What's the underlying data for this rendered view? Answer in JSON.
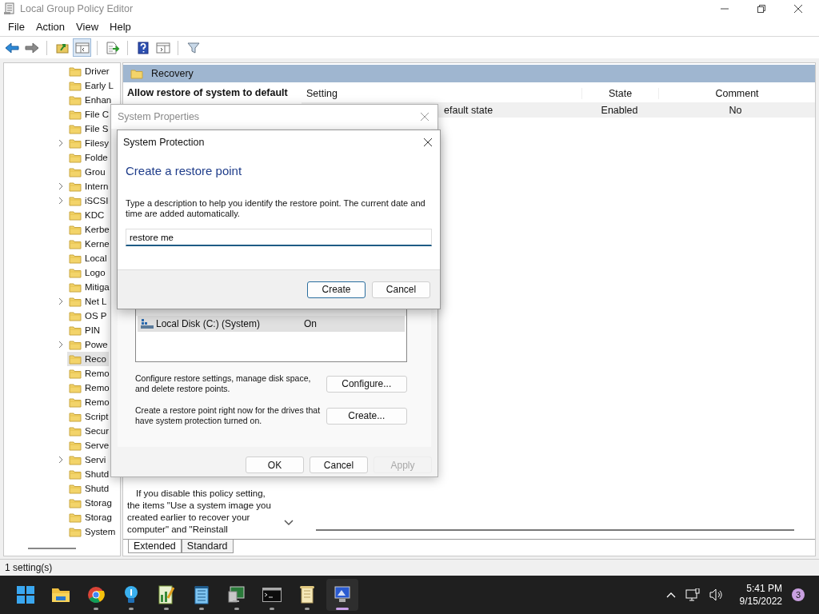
{
  "window": {
    "title": "Local Group Policy Editor"
  },
  "menu": [
    "File",
    "Action",
    "View",
    "Help"
  ],
  "toolbar": [
    {
      "buttons": [
        {
          "kind": "back",
          "selected": false
        },
        {
          "kind": "forward",
          "selected": false
        }
      ]
    },
    {
      "buttons": [
        {
          "kind": "up",
          "selected": false
        },
        {
          "kind": "tree",
          "selected": true
        }
      ]
    },
    {
      "buttons": [
        {
          "kind": "export",
          "selected": false
        }
      ]
    },
    {
      "buttons": [
        {
          "kind": "help",
          "selected": false
        },
        {
          "kind": "pane",
          "selected": false
        }
      ]
    },
    {
      "buttons": [
        {
          "kind": "filter",
          "selected": false
        }
      ]
    }
  ],
  "tree": {
    "items": [
      {
        "label": "Driver",
        "expandable": false,
        "selected": false
      },
      {
        "label": "Early L",
        "expandable": false,
        "selected": false
      },
      {
        "label": "Enhan",
        "expandable": false,
        "selected": false
      },
      {
        "label": "File C",
        "expandable": false,
        "selected": false
      },
      {
        "label": "File S",
        "expandable": false,
        "selected": false
      },
      {
        "label": "Filesy",
        "expandable": true,
        "selected": false
      },
      {
        "label": "Folde",
        "expandable": false,
        "selected": false
      },
      {
        "label": "Grou",
        "expandable": false,
        "selected": false
      },
      {
        "label": "Intern",
        "expandable": true,
        "selected": false
      },
      {
        "label": "iSCSI",
        "expandable": true,
        "selected": false
      },
      {
        "label": "KDC",
        "expandable": false,
        "selected": false
      },
      {
        "label": "Kerbe",
        "expandable": false,
        "selected": false
      },
      {
        "label": "Kerne",
        "expandable": false,
        "selected": false
      },
      {
        "label": "Local",
        "expandable": false,
        "selected": false
      },
      {
        "label": "Logo",
        "expandable": false,
        "selected": false
      },
      {
        "label": "Mitiga",
        "expandable": false,
        "selected": false
      },
      {
        "label": "Net L",
        "expandable": true,
        "selected": false
      },
      {
        "label": "OS P",
        "expandable": false,
        "selected": false
      },
      {
        "label": "PIN",
        "expandable": false,
        "selected": false
      },
      {
        "label": "Powe",
        "expandable": true,
        "selected": false
      },
      {
        "label": "Reco",
        "expandable": false,
        "selected": true
      },
      {
        "label": "Remo",
        "expandable": false,
        "selected": false
      },
      {
        "label": "Remo",
        "expandable": false,
        "selected": false
      },
      {
        "label": "Remo",
        "expandable": false,
        "selected": false
      },
      {
        "label": "Script",
        "expandable": false,
        "selected": false
      },
      {
        "label": "Secur",
        "expandable": false,
        "selected": false
      },
      {
        "label": "Serve",
        "expandable": false,
        "selected": false
      },
      {
        "label": "Servi",
        "expandable": true,
        "selected": false
      },
      {
        "label": "Shutd",
        "expandable": false,
        "selected": false
      },
      {
        "label": "Shutd",
        "expandable": false,
        "selected": false
      },
      {
        "label": "Storag",
        "expandable": false,
        "selected": false
      },
      {
        "label": "Storag",
        "expandable": false,
        "selected": false
      },
      {
        "label": "System",
        "expandable": false,
        "selected": false
      }
    ]
  },
  "details": {
    "header": "Recovery",
    "policy_title": "Allow restore of system to default",
    "description": "If you disable this policy setting, the items \"Use a system image you created earlier to recover your computer\" and \"Reinstall",
    "columns": [
      "Setting",
      "State",
      "Comment"
    ],
    "rows": [
      {
        "setting": "efault state",
        "state": "Enabled",
        "comment": "No",
        "selected": true
      }
    ],
    "view_tabs": [
      {
        "label": "Extended",
        "selected": true
      },
      {
        "label": "Standard",
        "selected": false
      }
    ]
  },
  "status_bar": "1 setting(s)",
  "system_properties": {
    "title": "System Properties",
    "drives": [
      {
        "name": "Local Disk (C:) (System)",
        "protection": "On",
        "selected": true
      }
    ],
    "actions": [
      {
        "text": "Configure restore settings, manage disk space, and delete restore points.",
        "button": "Configure..."
      },
      {
        "text": "Create a restore point right now for the drives that have system protection turned on.",
        "button": "Create..."
      }
    ],
    "buttons": [
      {
        "label": "OK",
        "disabled": false
      },
      {
        "label": "Cancel",
        "disabled": false
      },
      {
        "label": "Apply",
        "disabled": true
      }
    ]
  },
  "system_protection": {
    "title": "System Protection",
    "heading": "Create a restore point",
    "description": "Type a description to help you identify the restore point. The current date and time are added automatically.",
    "value": "restore me",
    "buttons": [
      {
        "label": "Create",
        "default": true
      },
      {
        "label": "Cancel",
        "default": false
      }
    ]
  },
  "taskbar": {
    "apps": [
      {
        "kind": "start",
        "running": false,
        "active": false
      },
      {
        "kind": "explorer",
        "running": false,
        "active": false
      },
      {
        "kind": "chrome",
        "running": true,
        "active": false
      },
      {
        "kind": "bulb",
        "running": true,
        "active": false
      },
      {
        "kind": "chart",
        "running": true,
        "active": false
      },
      {
        "kind": "notepad",
        "running": true,
        "active": false
      },
      {
        "kind": "monitor",
        "running": true,
        "active": false
      },
      {
        "kind": "terminal",
        "running": true,
        "active": false
      },
      {
        "kind": "scroll",
        "running": true,
        "active": false
      },
      {
        "kind": "policy",
        "running": true,
        "active": true
      }
    ],
    "time": "5:41 PM",
    "date": "9/15/2022",
    "notifications": "3"
  }
}
